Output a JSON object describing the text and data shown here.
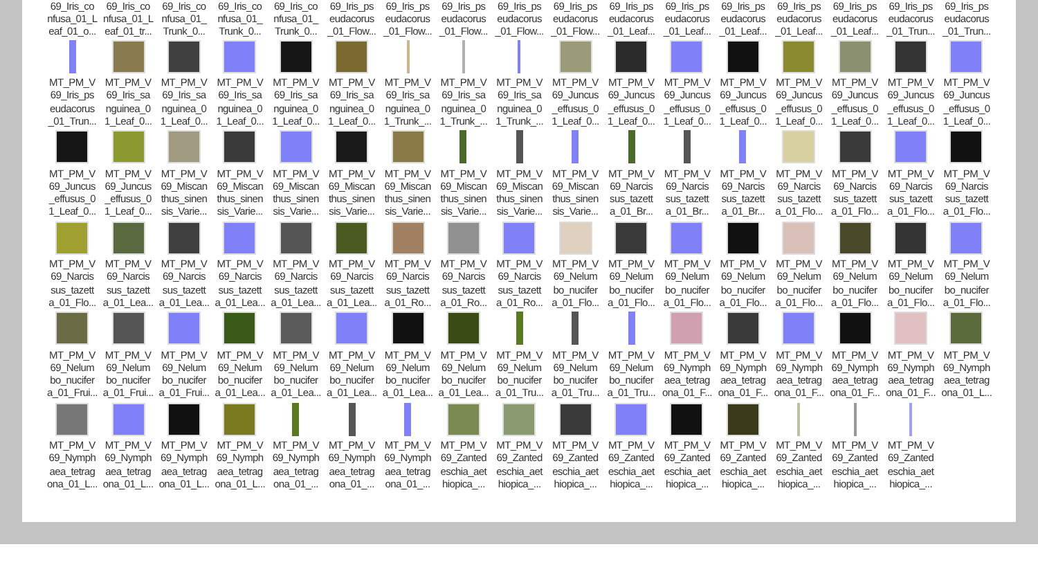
{
  "top_row": [
    {
      "label": [
        "69_Iris_co",
        "nfusa_01_L",
        "eaf_01_o..."
      ]
    },
    {
      "label": [
        "69_Iris_co",
        "nfusa_01_L",
        "eaf_01_tr..."
      ]
    },
    {
      "label": [
        "69_Iris_co",
        "nfusa_01_",
        "Trunk_0..."
      ]
    },
    {
      "label": [
        "69_Iris_co",
        "nfusa_01_",
        "Trunk_0..."
      ]
    },
    {
      "label": [
        "69_Iris_co",
        "nfusa_01_",
        "Trunk_0..."
      ]
    },
    {
      "label": [
        "69_Iris_ps",
        "eudacorus",
        "_01_Flow..."
      ]
    },
    {
      "label": [
        "69_Iris_ps",
        "eudacorus",
        "_01_Flow..."
      ]
    },
    {
      "label": [
        "69_Iris_ps",
        "eudacorus",
        "_01_Flow..."
      ]
    },
    {
      "label": [
        "69_Iris_ps",
        "eudacorus",
        "_01_Flow..."
      ]
    },
    {
      "label": [
        "69_Iris_ps",
        "eudacorus",
        "_01_Flow..."
      ]
    },
    {
      "label": [
        "69_Iris_ps",
        "eudacorus",
        "_01_Leaf..."
      ]
    },
    {
      "label": [
        "69_Iris_ps",
        "eudacorus",
        "_01_Leaf..."
      ]
    },
    {
      "label": [
        "69_Iris_ps",
        "eudacorus",
        "_01_Leaf..."
      ]
    },
    {
      "label": [
        "69_Iris_ps",
        "eudacorus",
        "_01_Leaf..."
      ]
    },
    {
      "label": [
        "69_Iris_ps",
        "eudacorus",
        "_01_Leaf..."
      ]
    },
    {
      "label": [
        "69_Iris_ps",
        "eudacorus",
        "_01_Trun..."
      ]
    },
    {
      "label": [
        "69_Iris_ps",
        "eudacorus",
        "_01_Trun..."
      ]
    }
  ],
  "rows": [
    [
      {
        "kind": "strip",
        "color": "#8080f8",
        "label": [
          "MT_PM_V",
          "69_Iris_ps",
          "eudacorus",
          "_01_Trun..."
        ]
      },
      {
        "kind": "square",
        "color": "#8a7a50",
        "label": [
          "MT_PM_V",
          "69_Iris_sa",
          "nguinea_0",
          "1_Leaf_0..."
        ]
      },
      {
        "kind": "square",
        "color": "#404040",
        "label": [
          "MT_PM_V",
          "69_Iris_sa",
          "nguinea_0",
          "1_Leaf_0..."
        ]
      },
      {
        "kind": "square",
        "color": "#8080f8",
        "label": [
          "MT_PM_V",
          "69_Iris_sa",
          "nguinea_0",
          "1_Leaf_0..."
        ]
      },
      {
        "kind": "square",
        "color": "#151515",
        "label": [
          "MT_PM_V",
          "69_Iris_sa",
          "nguinea_0",
          "1_Leaf_0..."
        ]
      },
      {
        "kind": "square",
        "color": "#7a6a30",
        "label": [
          "MT_PM_V",
          "69_Iris_sa",
          "nguinea_0",
          "1_Leaf_0..."
        ]
      },
      {
        "kind": "line",
        "color": "#c8b890",
        "label": [
          "MT_PM_V",
          "69_Iris_sa",
          "nguinea_0",
          "1_Trunk_..."
        ]
      },
      {
        "kind": "line",
        "color": "#b0b0b0",
        "label": [
          "MT_PM_V",
          "69_Iris_sa",
          "nguinea_0",
          "1_Trunk_..."
        ]
      },
      {
        "kind": "line",
        "color": "#8080f8",
        "label": [
          "MT_PM_V",
          "69_Iris_sa",
          "nguinea_0",
          "1_Trunk_..."
        ]
      },
      {
        "kind": "square",
        "color": "#9a9a78",
        "label": [
          "MT_PM_V",
          "69_Juncus",
          "_effusus_0",
          "1_Leaf_0..."
        ]
      },
      {
        "kind": "square",
        "color": "#2a2a2a",
        "label": [
          "MT_PM_V",
          "69_Juncus",
          "_effusus_0",
          "1_Leaf_0..."
        ]
      },
      {
        "kind": "square",
        "color": "#8080f8",
        "label": [
          "MT_PM_V",
          "69_Juncus",
          "_effusus_0",
          "1_Leaf_0..."
        ]
      },
      {
        "kind": "square",
        "color": "#111111",
        "label": [
          "MT_PM_V",
          "69_Juncus",
          "_effusus_0",
          "1_Leaf_0..."
        ]
      },
      {
        "kind": "square",
        "color": "#8a8a30",
        "label": [
          "MT_PM_V",
          "69_Juncus",
          "_effusus_0",
          "1_Leaf_0..."
        ]
      },
      {
        "kind": "square",
        "color": "#8a9070",
        "label": [
          "MT_PM_V",
          "69_Juncus",
          "_effusus_0",
          "1_Leaf_0..."
        ]
      },
      {
        "kind": "square",
        "color": "#333333",
        "label": [
          "MT_PM_V",
          "69_Juncus",
          "_effusus_0",
          "1_Leaf_0..."
        ]
      },
      {
        "kind": "square",
        "color": "#8080f8",
        "label": [
          "MT_PM_V",
          "69_Juncus",
          "_effusus_0",
          "1_Leaf_0..."
        ]
      }
    ],
    [
      {
        "kind": "square",
        "color": "#151515",
        "label": [
          "MT_PM_V",
          "69_Juncus",
          "_effusus_0",
          "1_Leaf_0..."
        ]
      },
      {
        "kind": "square",
        "color": "#8a9a30",
        "label": [
          "MT_PM_V",
          "69_Juncus",
          "_effusus_0",
          "1_Leaf_0..."
        ]
      },
      {
        "kind": "square",
        "color": "#a09a80",
        "label": [
          "MT_PM_V",
          "69_Miscan",
          "thus_sinen",
          "sis_Varie..."
        ]
      },
      {
        "kind": "square",
        "color": "#3a3a3a",
        "label": [
          "MT_PM_V",
          "69_Miscan",
          "thus_sinen",
          "sis_Varie..."
        ]
      },
      {
        "kind": "square",
        "color": "#8080f8",
        "label": [
          "MT_PM_V",
          "69_Miscan",
          "thus_sinen",
          "sis_Varie..."
        ]
      },
      {
        "kind": "square",
        "color": "#1a1a1a",
        "label": [
          "MT_PM_V",
          "69_Miscan",
          "thus_sinen",
          "sis_Varie..."
        ]
      },
      {
        "kind": "square",
        "color": "#8a7a45",
        "label": [
          "MT_PM_V",
          "69_Miscan",
          "thus_sinen",
          "sis_Varie..."
        ]
      },
      {
        "kind": "strip",
        "color": "#4a6a2a",
        "label": [
          "MT_PM_V",
          "69_Miscan",
          "thus_sinen",
          "sis_Varie..."
        ]
      },
      {
        "kind": "strip",
        "color": "#555555",
        "label": [
          "MT_PM_V",
          "69_Miscan",
          "thus_sinen",
          "sis_Varie..."
        ]
      },
      {
        "kind": "strip",
        "color": "#8080f8",
        "label": [
          "MT_PM_V",
          "69_Miscan",
          "thus_sinen",
          "sis_Varie..."
        ]
      },
      {
        "kind": "strip",
        "color": "#4a6a2a",
        "label": [
          "MT_PM_V",
          "69_Narcis",
          "sus_tazett",
          "a_01_Br..."
        ]
      },
      {
        "kind": "strip",
        "color": "#555555",
        "label": [
          "MT_PM_V",
          "69_Narcis",
          "sus_tazett",
          "a_01_Br..."
        ]
      },
      {
        "kind": "strip",
        "color": "#8080f8",
        "label": [
          "MT_PM_V",
          "69_Narcis",
          "sus_tazett",
          "a_01_Br..."
        ]
      },
      {
        "kind": "square",
        "color": "#d8d0a0",
        "label": [
          "MT_PM_V",
          "69_Narcis",
          "sus_tazett",
          "a_01_Flo..."
        ]
      },
      {
        "kind": "square",
        "color": "#3a3a3a",
        "label": [
          "MT_PM_V",
          "69_Narcis",
          "sus_tazett",
          "a_01_Flo..."
        ]
      },
      {
        "kind": "square",
        "color": "#8080f8",
        "label": [
          "MT_PM_V",
          "69_Narcis",
          "sus_tazett",
          "a_01_Flo..."
        ]
      },
      {
        "kind": "square",
        "color": "#111111",
        "label": [
          "MT_PM_V",
          "69_Narcis",
          "sus_tazett",
          "a_01_Flo..."
        ]
      }
    ],
    [
      {
        "kind": "square",
        "color": "#a0a030",
        "label": [
          "MT_PM_V",
          "69_Narcis",
          "sus_tazett",
          "a_01_Flo..."
        ]
      },
      {
        "kind": "square",
        "color": "#5a6a40",
        "label": [
          "MT_PM_V",
          "69_Narcis",
          "sus_tazett",
          "a_01_Lea..."
        ]
      },
      {
        "kind": "square",
        "color": "#404040",
        "label": [
          "MT_PM_V",
          "69_Narcis",
          "sus_tazett",
          "a_01_Lea..."
        ]
      },
      {
        "kind": "square",
        "color": "#8080f8",
        "label": [
          "MT_PM_V",
          "69_Narcis",
          "sus_tazett",
          "a_01_Lea..."
        ]
      },
      {
        "kind": "square",
        "color": "#555555",
        "label": [
          "MT_PM_V",
          "69_Narcis",
          "sus_tazett",
          "a_01_Lea..."
        ]
      },
      {
        "kind": "square",
        "color": "#4a5a20",
        "label": [
          "MT_PM_V",
          "69_Narcis",
          "sus_tazett",
          "a_01_Lea..."
        ]
      },
      {
        "kind": "square",
        "color": "#a08060",
        "label": [
          "MT_PM_V",
          "69_Narcis",
          "sus_tazett",
          "a_01_Ro..."
        ]
      },
      {
        "kind": "square",
        "color": "#909090",
        "label": [
          "MT_PM_V",
          "69_Narcis",
          "sus_tazett",
          "a_01_Ro..."
        ]
      },
      {
        "kind": "square",
        "color": "#8080f8",
        "label": [
          "MT_PM_V",
          "69_Narcis",
          "sus_tazett",
          "a_01_Ro..."
        ]
      },
      {
        "kind": "square",
        "color": "#e0d0c0",
        "label": [
          "MT_PM_V",
          "69_Nelum",
          "bo_nucifer",
          "a_01_Flo..."
        ]
      },
      {
        "kind": "square",
        "color": "#3a3a3a",
        "label": [
          "MT_PM_V",
          "69_Nelum",
          "bo_nucifer",
          "a_01_Flo..."
        ]
      },
      {
        "kind": "square",
        "color": "#8080f8",
        "label": [
          "MT_PM_V",
          "69_Nelum",
          "bo_nucifer",
          "a_01_Flo..."
        ]
      },
      {
        "kind": "square",
        "color": "#111111",
        "label": [
          "MT_PM_V",
          "69_Nelum",
          "bo_nucifer",
          "a_01_Flo..."
        ]
      },
      {
        "kind": "square",
        "color": "#d8c0b8",
        "label": [
          "MT_PM_V",
          "69_Nelum",
          "bo_nucifer",
          "a_01_Flo..."
        ]
      },
      {
        "kind": "square",
        "color": "#4a4a2a",
        "label": [
          "MT_PM_V",
          "69_Nelum",
          "bo_nucifer",
          "a_01_Flo..."
        ]
      },
      {
        "kind": "square",
        "color": "#333333",
        "label": [
          "MT_PM_V",
          "69_Nelum",
          "bo_nucifer",
          "a_01_Flo..."
        ]
      },
      {
        "kind": "square",
        "color": "#8080f8",
        "label": [
          "MT_PM_V",
          "69_Nelum",
          "bo_nucifer",
          "a_01_Flo..."
        ]
      }
    ],
    [
      {
        "kind": "square",
        "color": "#6a6a45",
        "label": [
          "MT_PM_V",
          "69_Nelum",
          "bo_nucifer",
          "a_01_Frui..."
        ]
      },
      {
        "kind": "square",
        "color": "#555555",
        "label": [
          "MT_PM_V",
          "69_Nelum",
          "bo_nucifer",
          "a_01_Frui..."
        ]
      },
      {
        "kind": "square",
        "color": "#8080f8",
        "label": [
          "MT_PM_V",
          "69_Nelum",
          "bo_nucifer",
          "a_01_Frui..."
        ]
      },
      {
        "kind": "square",
        "color": "#3a5a1a",
        "label": [
          "MT_PM_V",
          "69_Nelum",
          "bo_nucifer",
          "a_01_Lea..."
        ]
      },
      {
        "kind": "square",
        "color": "#5a5a5a",
        "label": [
          "MT_PM_V",
          "69_Nelum",
          "bo_nucifer",
          "a_01_Lea..."
        ]
      },
      {
        "kind": "square",
        "color": "#8080f8",
        "label": [
          "MT_PM_V",
          "69_Nelum",
          "bo_nucifer",
          "a_01_Lea..."
        ]
      },
      {
        "kind": "square",
        "color": "#111111",
        "label": [
          "MT_PM_V",
          "69_Nelum",
          "bo_nucifer",
          "a_01_Lea..."
        ]
      },
      {
        "kind": "square",
        "color": "#3a4a15",
        "label": [
          "MT_PM_V",
          "69_Nelum",
          "bo_nucifer",
          "a_01_Lea..."
        ]
      },
      {
        "kind": "strip",
        "color": "#5a7a20",
        "label": [
          "MT_PM_V",
          "69_Nelum",
          "bo_nucifer",
          "a_01_Tru..."
        ]
      },
      {
        "kind": "strip",
        "color": "#555555",
        "label": [
          "MT_PM_V",
          "69_Nelum",
          "bo_nucifer",
          "a_01_Tru..."
        ]
      },
      {
        "kind": "strip",
        "color": "#8080f8",
        "label": [
          "MT_PM_V",
          "69_Nelum",
          "bo_nucifer",
          "a_01_Tru..."
        ]
      },
      {
        "kind": "square",
        "color": "#d0a0b0",
        "label": [
          "MT_PM_V",
          "69_Nymph",
          "aea_tetrag",
          "ona_01_F..."
        ]
      },
      {
        "kind": "square",
        "color": "#3a3a3a",
        "label": [
          "MT_PM_V",
          "69_Nymph",
          "aea_tetrag",
          "ona_01_F..."
        ]
      },
      {
        "kind": "square",
        "color": "#8080f8",
        "label": [
          "MT_PM_V",
          "69_Nymph",
          "aea_tetrag",
          "ona_01_F..."
        ]
      },
      {
        "kind": "square",
        "color": "#111111",
        "label": [
          "MT_PM_V",
          "69_Nymph",
          "aea_tetrag",
          "ona_01_F..."
        ]
      },
      {
        "kind": "square",
        "color": "#e0c0c0",
        "label": [
          "MT_PM_V",
          "69_Nymph",
          "aea_tetrag",
          "ona_01_F..."
        ]
      },
      {
        "kind": "square",
        "color": "#5a6a3a",
        "label": [
          "MT_PM_V",
          "69_Nymph",
          "aea_tetrag",
          "ona_01_L..."
        ]
      }
    ],
    [
      {
        "kind": "square",
        "color": "#777777",
        "label": [
          "MT_PM_V",
          "69_Nymph",
          "aea_tetrag",
          "ona_01_L..."
        ]
      },
      {
        "kind": "square",
        "color": "#8080f8",
        "label": [
          "MT_PM_V",
          "69_Nymph",
          "aea_tetrag",
          "ona_01_L..."
        ]
      },
      {
        "kind": "square",
        "color": "#111111",
        "label": [
          "MT_PM_V",
          "69_Nymph",
          "aea_tetrag",
          "ona_01_L..."
        ]
      },
      {
        "kind": "square",
        "color": "#7a7a20",
        "label": [
          "MT_PM_V",
          "69_Nymph",
          "aea_tetrag",
          "ona_01_L..."
        ]
      },
      {
        "kind": "strip",
        "color": "#5a7a20",
        "label": [
          "MT_PM_V",
          "69_Nymph",
          "aea_tetrag",
          "ona_01_..."
        ]
      },
      {
        "kind": "strip",
        "color": "#555555",
        "label": [
          "MT_PM_V",
          "69_Nymph",
          "aea_tetrag",
          "ona_01_..."
        ]
      },
      {
        "kind": "strip",
        "color": "#8080f8",
        "label": [
          "MT_PM_V",
          "69_Nymph",
          "aea_tetrag",
          "ona_01_..."
        ]
      },
      {
        "kind": "square",
        "color": "#7a8a50",
        "label": [
          "MT_PM_V",
          "69_Zanted",
          "eschia_aet",
          "hiopica_..."
        ]
      },
      {
        "kind": "square",
        "color": "#8a9a70",
        "label": [
          "MT_PM_V",
          "69_Zanted",
          "eschia_aet",
          "hiopica_..."
        ]
      },
      {
        "kind": "square",
        "color": "#3a3a3a",
        "label": [
          "MT_PM_V",
          "69_Zanted",
          "eschia_aet",
          "hiopica_..."
        ]
      },
      {
        "kind": "square",
        "color": "#8080f8",
        "label": [
          "MT_PM_V",
          "69_Zanted",
          "eschia_aet",
          "hiopica_..."
        ]
      },
      {
        "kind": "square",
        "color": "#111111",
        "label": [
          "MT_PM_V",
          "69_Zanted",
          "eschia_aet",
          "hiopica_..."
        ]
      },
      {
        "kind": "square",
        "color": "#3a3a1a",
        "label": [
          "MT_PM_V",
          "69_Zanted",
          "eschia_aet",
          "hiopica_..."
        ]
      },
      {
        "kind": "line",
        "color": "#c0c0a0",
        "label": [
          "MT_PM_V",
          "69_Zanted",
          "eschia_aet",
          "hiopica_..."
        ]
      },
      {
        "kind": "line",
        "color": "#999999",
        "label": [
          "MT_PM_V",
          "69_Zanted",
          "eschia_aet",
          "hiopica_..."
        ]
      },
      {
        "kind": "line",
        "color": "#a0a0f0",
        "label": [
          "MT_PM_V",
          "69_Zanted",
          "eschia_aet",
          "hiopica_..."
        ]
      }
    ]
  ]
}
